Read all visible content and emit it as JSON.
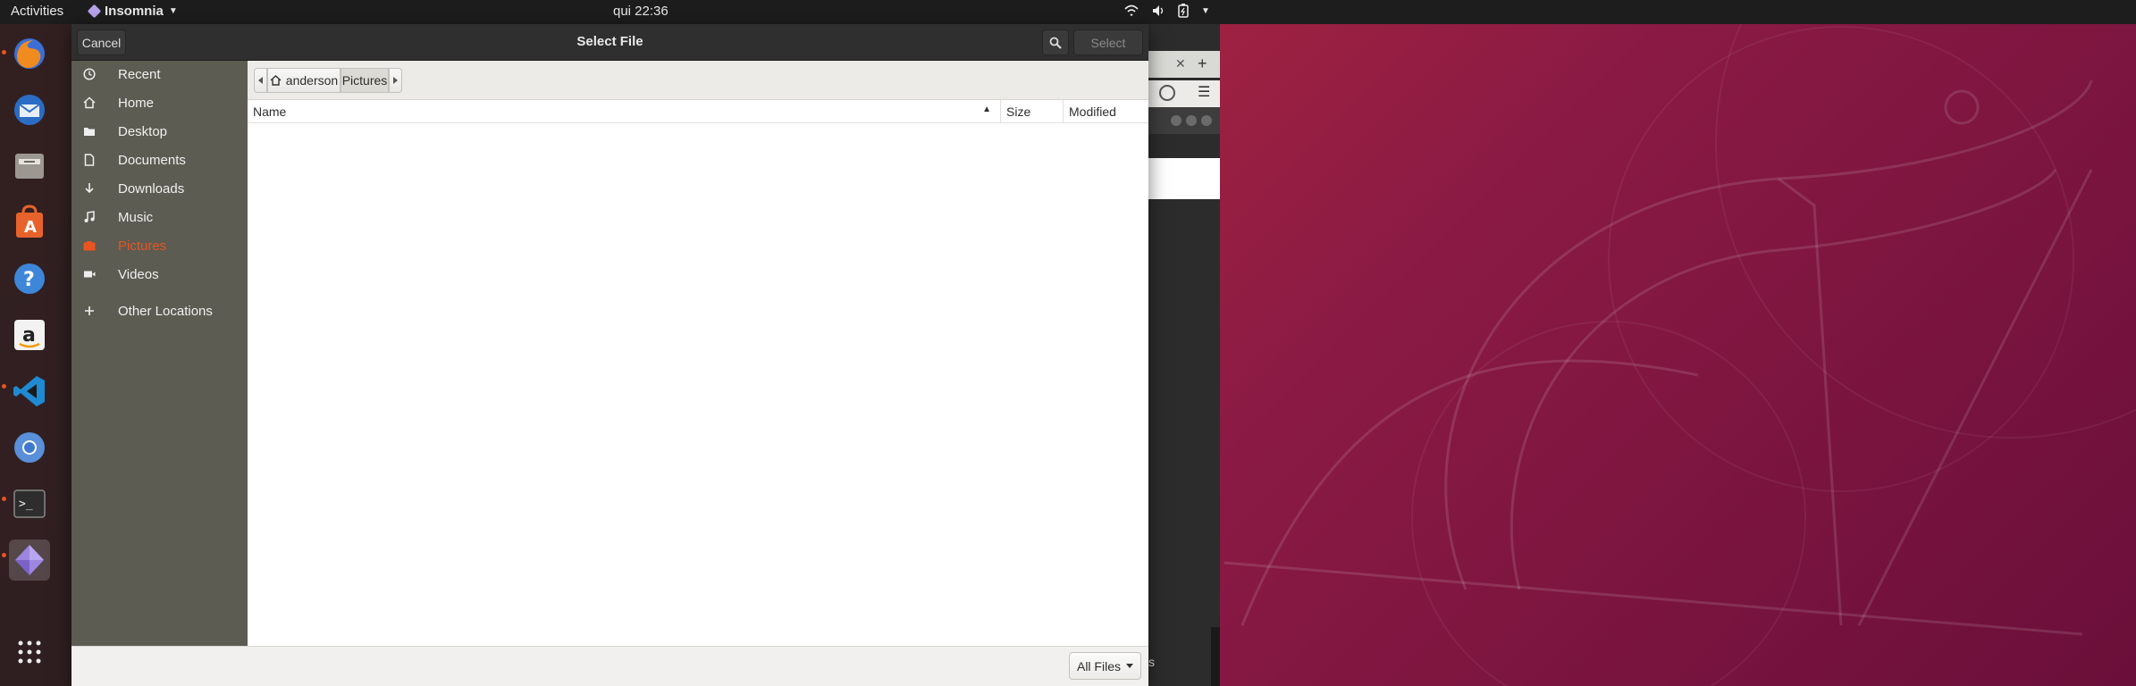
{
  "topbar": {
    "activities": "Activities",
    "app_name": "Insomnia",
    "clock": "qui 22:36",
    "tray_icons": [
      "wifi-icon",
      "volume-icon",
      "battery-icon",
      "system-menu-caret"
    ]
  },
  "dock": {
    "apps": [
      "Firefox",
      "Thunderbird",
      "Files",
      "Ubuntu Software",
      "Help",
      "Amazon",
      "Visual Studio Code",
      "Chromium",
      "Terminal",
      "Insomnia",
      "Show Applications"
    ]
  },
  "dialog": {
    "title": "Select  File",
    "cancel_label": "Cancel",
    "select_label": "Select",
    "search_icon": "search-icon",
    "places": [
      {
        "label": "Recent",
        "icon": "clock-icon"
      },
      {
        "label": "Home",
        "icon": "home-icon"
      },
      {
        "label": "Desktop",
        "icon": "folder-icon"
      },
      {
        "label": "Documents",
        "icon": "document-icon"
      },
      {
        "label": "Downloads",
        "icon": "download-icon"
      },
      {
        "label": "Music",
        "icon": "music-icon"
      },
      {
        "label": "Pictures",
        "icon": "camera-icon",
        "active": true
      },
      {
        "label": "Videos",
        "icon": "video-icon"
      },
      {
        "label": "Other Locations",
        "icon": "plus-icon"
      }
    ],
    "path": [
      "anderson",
      "Pictures"
    ],
    "columns": {
      "name": "Name",
      "size": "Size",
      "modified": "Modified"
    },
    "filter": "All Files",
    "files": []
  },
  "background_window": {
    "partial_text": "s"
  },
  "colors": {
    "accent": "#e95420",
    "sidebar": "#5c5c52",
    "headerbar": "#2f2f2f"
  }
}
